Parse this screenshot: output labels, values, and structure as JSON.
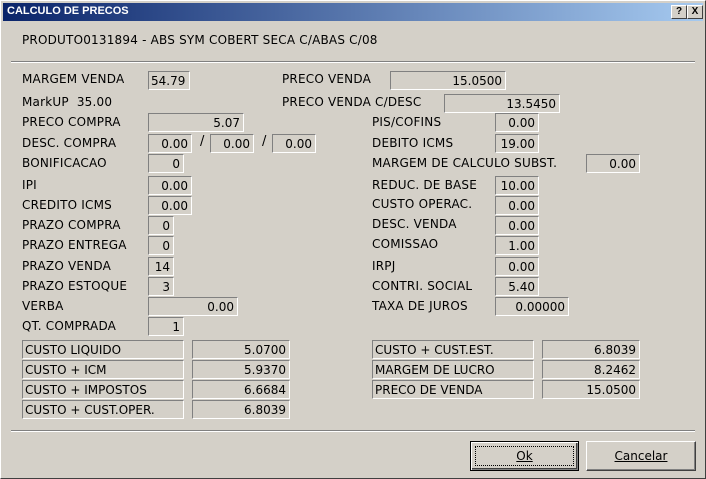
{
  "window": {
    "title": "CALCULO DE PRECOS",
    "help_btn": "?",
    "close_btn": "X"
  },
  "product": "PRODUTO0131894 - ABS SYM COBERT SECA C/ABAS C/08",
  "margem_venda": {
    "label": "MARGEM VENDA",
    "value": "54.79"
  },
  "markup": {
    "label": "MarkUP",
    "value": "35.00"
  },
  "preco_venda": {
    "label": "PRECO VENDA",
    "value": "15.0500"
  },
  "preco_venda_desc": {
    "label": "PRECO VENDA C/DESC",
    "value": "13.5450"
  },
  "left_fields": {
    "preco_compra": {
      "label": "PRECO COMPRA",
      "value": "5.07"
    },
    "desc_compra": {
      "label": "DESC. COMPRA",
      "v1": "0.00",
      "v2": "0.00",
      "v3": "0.00",
      "sep": "/"
    },
    "bonificacao": {
      "label": "BONIFICACAO",
      "value": "0"
    },
    "ipi": {
      "label": "IPI",
      "value": "0.00"
    },
    "credito_icms": {
      "label": "CREDITO ICMS",
      "value": "0.00"
    },
    "prazo_compra": {
      "label": "PRAZO COMPRA",
      "value": "0"
    },
    "prazo_entrega": {
      "label": "PRAZO ENTREGA",
      "value": "0"
    },
    "prazo_venda": {
      "label": "PRAZO VENDA",
      "value": "14"
    },
    "prazo_estoque": {
      "label": "PRAZO ESTOQUE",
      "value": "3"
    },
    "verba": {
      "label": "VERBA",
      "value": "0.00"
    },
    "qt_comprada": {
      "label": "QT. COMPRADA",
      "value": "1"
    }
  },
  "right_fields": {
    "pis_cofins": {
      "label": "PIS/COFINS",
      "value": "0.00"
    },
    "debito_icms": {
      "label": "DEBITO ICMS",
      "value": "19.00"
    },
    "margem_calc_subst": {
      "label": "MARGEM DE CALCULO SUBST.",
      "value": "0.00"
    },
    "reduc_base": {
      "label": "REDUC. DE BASE",
      "value": "10.00"
    },
    "custo_operac": {
      "label": "CUSTO OPERAC.",
      "value": "0.00"
    },
    "desc_venda": {
      "label": "DESC. VENDA",
      "value": "0.00"
    },
    "comissao": {
      "label": "COMISSAO",
      "value": "1.00"
    },
    "irpj": {
      "label": "IRPJ",
      "value": "0.00"
    },
    "contri_social": {
      "label": "CONTRI. SOCIAL",
      "value": "5.40"
    },
    "taxa_juros": {
      "label": "TAXA DE JUROS",
      "value": "0.00000"
    }
  },
  "summary_left": [
    {
      "label": "CUSTO LIQUIDO",
      "value": "5.0700"
    },
    {
      "label": "CUSTO + ICM",
      "value": "5.9370"
    },
    {
      "label": "CUSTO + IMPOSTOS",
      "value": "6.6684"
    },
    {
      "label": "CUSTO + CUST.OPER.",
      "value": "6.8039"
    }
  ],
  "summary_right": [
    {
      "label": "CUSTO + CUST.EST.",
      "value": "6.8039"
    },
    {
      "label": "MARGEM DE LUCRO",
      "value": "8.2462"
    },
    {
      "label": "PRECO DE VENDA",
      "value": "15.0500"
    }
  ],
  "buttons": {
    "ok": "Ok",
    "cancel": "Cancelar"
  }
}
